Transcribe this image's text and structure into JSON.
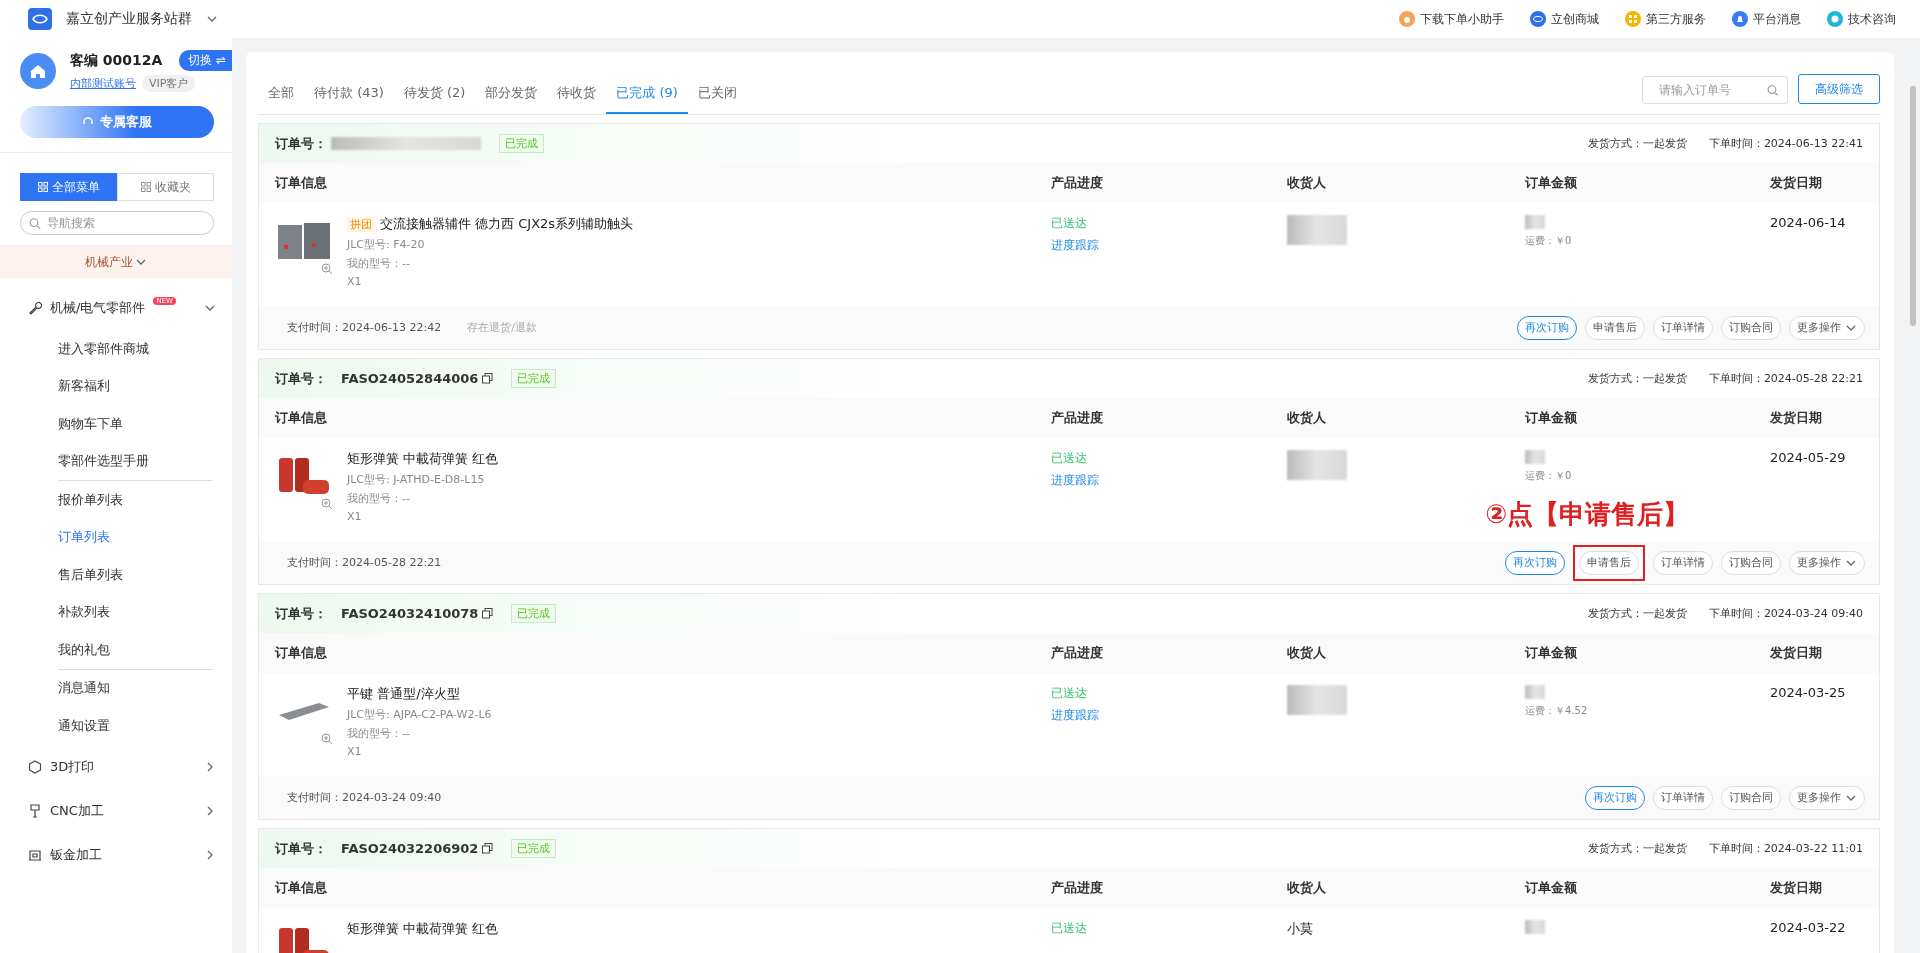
{
  "topbar": {
    "title": "嘉立创产业服务站群",
    "links": [
      {
        "label": "下载下单小助手",
        "kind": "bear",
        "color": "#f5a35c"
      },
      {
        "label": "立创商城",
        "kind": "globe",
        "color": "#2f6fe8"
      },
      {
        "label": "第三方服务",
        "kind": "grid",
        "color": "#f7b500"
      },
      {
        "label": "平台消息",
        "kind": "bell",
        "color": "#3b7cf5"
      },
      {
        "label": "技术咨询",
        "kind": "chat",
        "color": "#1fb4d8"
      }
    ]
  },
  "sidebar": {
    "account": {
      "name": "客编 00012A",
      "switch_label": "切换 ⇌",
      "link": "内部测试账号",
      "tag": "VIP客户"
    },
    "service_button": "专属客服",
    "menu_tabs": [
      {
        "label": "全部菜单",
        "selected": true
      },
      {
        "label": "收藏夹",
        "selected": false
      }
    ],
    "search": {
      "placeholder": "导航搜索"
    },
    "industry": "机械产业",
    "items": [
      {
        "label": "机械/电气零部件",
        "kind": "wrench",
        "badge": "NEW",
        "expanded": true,
        "children": [
          {
            "label": "进入零部件商城",
            "selected": false,
            "divider_before": false
          },
          {
            "label": "新客福利",
            "selected": false,
            "divider_before": false
          },
          {
            "label": "购物车下单",
            "selected": false,
            "divider_before": false
          },
          {
            "label": "零部件选型手册",
            "selected": false,
            "divider_before": false
          },
          {
            "label": "报价单列表",
            "selected": false,
            "divider_before": true
          },
          {
            "label": "订单列表",
            "selected": true,
            "divider_before": false
          },
          {
            "label": "售后单列表",
            "selected": false,
            "divider_before": false
          },
          {
            "label": "补款列表",
            "selected": false,
            "divider_before": false
          },
          {
            "label": "我的礼包",
            "selected": false,
            "divider_before": false
          },
          {
            "label": "消息通知",
            "selected": false,
            "divider_before": true
          },
          {
            "label": "通知设置",
            "selected": false,
            "divider_before": false
          }
        ]
      },
      {
        "label": "3D打印",
        "kind": "cube",
        "expanded": false
      },
      {
        "label": "CNC加工",
        "kind": "drill",
        "expanded": false
      },
      {
        "label": "钣金加工",
        "kind": "sheet",
        "expanded": false
      }
    ]
  },
  "main": {
    "tabs": [
      {
        "label": "全部",
        "selected": false
      },
      {
        "label": "待付款 (43)",
        "selected": false
      },
      {
        "label": "待发货 (2)",
        "selected": false
      },
      {
        "label": "部分发货",
        "selected": false
      },
      {
        "label": "待收货",
        "selected": false
      },
      {
        "label": "已完成 (9)",
        "selected": true
      },
      {
        "label": "已关闭",
        "selected": false
      }
    ],
    "search": {
      "placeholder": "请输入订单号"
    },
    "filter_button": "高级筛选",
    "orders": [
      {
        "number_label": "订单号：",
        "number_blurred": true,
        "status": "已完成",
        "shipping": "发货方式：一起发货",
        "order_time": "下单时间：2024-06-13 22:41",
        "columns": [
          "订单信息",
          "产品进度",
          "收货人",
          "订单金额",
          "发货日期"
        ],
        "product": {
          "kind": "contactor",
          "tag": "拼团",
          "name": "交流接触器辅件 德力西 CJX2s系列辅助触头",
          "model": "JLC型号: F4-20",
          "my_model": "我的型号：--",
          "qty": "X1"
        },
        "progress": "已送达",
        "track": "进度跟踪",
        "recipient_blurred": true,
        "freight": "运费：￥0",
        "ship_date": "2024-06-14",
        "pay_time": "支付时间：2024-06-13 22:42",
        "note": "存在退货/退款",
        "buttons": [
          {
            "label": "再次订购",
            "primary": true,
            "highlighted": false
          },
          {
            "label": "申请售后",
            "primary": false,
            "highlighted": false
          },
          {
            "label": "订单详情",
            "primary": false,
            "highlighted": false
          },
          {
            "label": "订购合同",
            "primary": false,
            "highlighted": false
          },
          {
            "label": "更多操作",
            "primary": false,
            "highlighted": false,
            "dropdown": true
          }
        ]
      },
      {
        "number_label": "订单号：",
        "number": "FASO24052844006",
        "number_blurred": false,
        "status": "已完成",
        "shipping": "发货方式：一起发货",
        "order_time": "下单时间：2024-05-28 22:21",
        "columns": [
          "订单信息",
          "产品进度",
          "收货人",
          "订单金额",
          "发货日期"
        ],
        "product": {
          "kind": "spring",
          "name": "矩形弹簧 中載荷弹簧 红色",
          "model": "JLC型号: J-ATHD-E-D8-L15",
          "my_model": "我的型号：--",
          "qty": "X1"
        },
        "progress": "已送达",
        "track": "进度跟踪",
        "recipient_blurred": true,
        "freight": "运费：￥0",
        "ship_date": "2024-05-29",
        "pay_time": "支付时间：2024-05-28 22:21",
        "annotation": "②点【申请售后】",
        "buttons": [
          {
            "label": "再次订购",
            "primary": true,
            "highlighted": false
          },
          {
            "label": "申请售后",
            "primary": false,
            "highlighted": true
          },
          {
            "label": "订单详情",
            "primary": false,
            "highlighted": false
          },
          {
            "label": "订购合同",
            "primary": false,
            "highlighted": false
          },
          {
            "label": "更多操作",
            "primary": false,
            "highlighted": false,
            "dropdown": true
          }
        ]
      },
      {
        "number_label": "订单号：",
        "number": "FASO24032410078",
        "number_blurred": false,
        "status": "已完成",
        "shipping": "发货方式：一起发货",
        "order_time": "下单时间：2024-03-24 09:40",
        "columns": [
          "订单信息",
          "产品进度",
          "收货人",
          "订单金额",
          "发货日期"
        ],
        "product": {
          "kind": "key",
          "name": "平键 普通型/淬火型",
          "model": "JLC型号: AJPA-C2-PA-W2-L6",
          "my_model": "我的型号：--",
          "qty": "X1"
        },
        "progress": "已送达",
        "track": "进度跟踪",
        "recipient_blurred": true,
        "freight": "运费：￥4.52",
        "ship_date": "2024-03-25",
        "pay_time": "支付时间：2024-03-24 09:40",
        "buttons": [
          {
            "label": "再次订购",
            "primary": true,
            "highlighted": false
          },
          {
            "label": "订单详情",
            "primary": false,
            "highlighted": false
          },
          {
            "label": "订购合同",
            "primary": false,
            "highlighted": false
          },
          {
            "label": "更多操作",
            "primary": false,
            "highlighted": false,
            "dropdown": true
          }
        ]
      },
      {
        "number_label": "订单号：",
        "number": "FASO24032206902",
        "number_blurred": false,
        "status": "已完成",
        "shipping": "发货方式：一起发货",
        "order_time": "下单时间：2024-03-22 11:01",
        "columns": [
          "订单信息",
          "产品进度",
          "收货人",
          "订单金额",
          "发货日期"
        ],
        "product": {
          "kind": "spring",
          "name": "矩形弹簧 中載荷弹簧 红色"
        },
        "progress": "已送达",
        "recipient_blurred": false,
        "recipient": "小莫",
        "ship_date": "2024-03-22"
      }
    ]
  }
}
